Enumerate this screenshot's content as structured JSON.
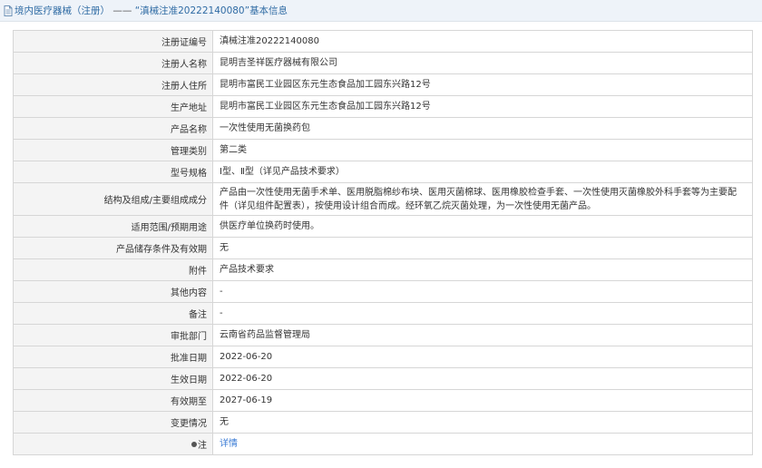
{
  "header": {
    "category": "境内医疗器械（注册）",
    "dash": " —— ",
    "quoted_reg": "“滇械注准20222140080”",
    "suffix": "基本信息"
  },
  "rows": [
    {
      "label": "注册证编号",
      "value": "滇械注准20222140080"
    },
    {
      "label": "注册人名称",
      "value": "昆明吉圣祥医疗器械有限公司"
    },
    {
      "label": "注册人住所",
      "value": "昆明市富民工业园区东元生态食品加工园东兴路12号"
    },
    {
      "label": "生产地址",
      "value": "昆明市富民工业园区东元生态食品加工园东兴路12号"
    },
    {
      "label": "产品名称",
      "value": "一次性使用无菌换药包"
    },
    {
      "label": "管理类别",
      "value": "第二类"
    },
    {
      "label": "型号规格",
      "value": "Ⅰ型、Ⅱ型（详见产品技术要求）"
    },
    {
      "label": "结构及组成/主要组成成分",
      "value": "产品由一次性使用无菌手术单、医用脱脂棉纱布块、医用灭菌棉球、医用橡胶检查手套、一次性使用灭菌橡胶外科手套等为主要配件（详见组件配置表），按使用设计组合而成。经环氧乙烷灭菌处理，为一次性使用无菌产品。"
    },
    {
      "label": "适用范围/预期用途",
      "value": "供医疗单位换药时使用。"
    },
    {
      "label": "产品储存条件及有效期",
      "value": "无"
    },
    {
      "label": "附件",
      "value": "产品技术要求"
    },
    {
      "label": "其他内容",
      "value": "-"
    },
    {
      "label": "备注",
      "value": "-"
    },
    {
      "label": "审批部门",
      "value": "云南省药品监督管理局"
    },
    {
      "label": "批准日期",
      "value": "2022-06-20"
    },
    {
      "label": "生效日期",
      "value": "2022-06-20"
    },
    {
      "label": "有效期至",
      "value": "2027-06-19"
    },
    {
      "label": "变更情况",
      "value": "无"
    },
    {
      "label": "注",
      "value": "详情"
    }
  ],
  "colors": {
    "header_bg": "#eef3f9",
    "label_bg": "#f4f4f4",
    "border": "#d6d6d6",
    "link": "#3a7bd5"
  }
}
